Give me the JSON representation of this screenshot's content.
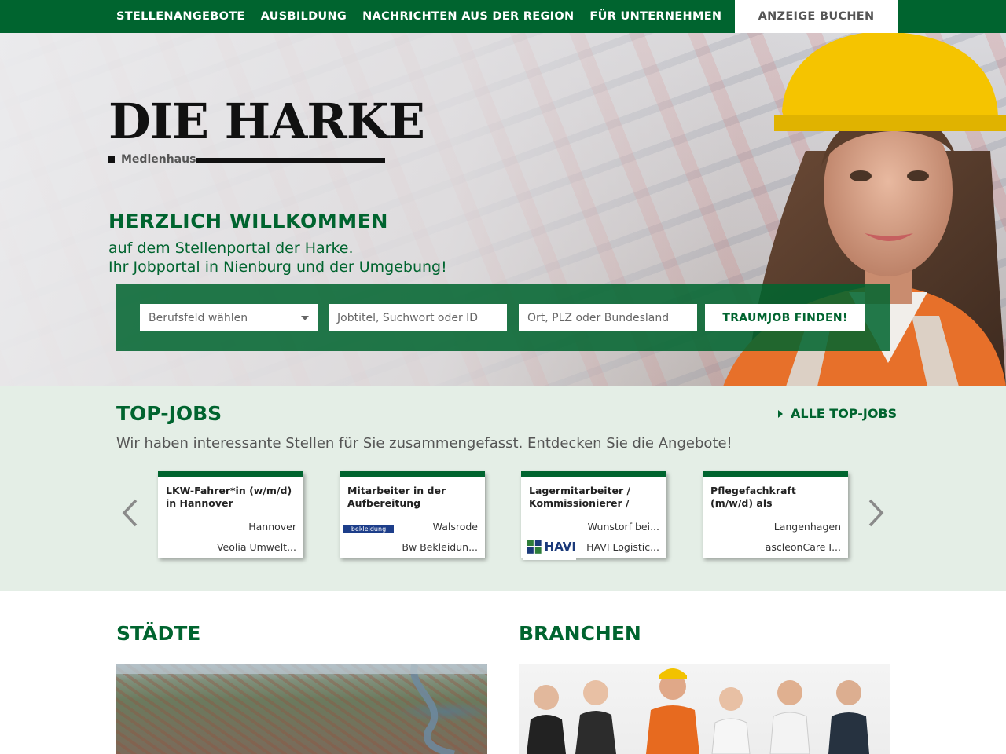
{
  "nav": {
    "links": [
      "STELLENANGEBOTE",
      "AUSBILDUNG",
      "NACHRICHTEN AUS DER REGION",
      "FÜR UNTERNEHMEN"
    ],
    "cta": "ANZEIGE BUCHEN"
  },
  "logo": {
    "line1": "DIE HARKE",
    "sub": "Medienhaus"
  },
  "hero": {
    "title": "HERZLICH WILLKOMMEN",
    "line1": "auf dem Stellenportal der Harke.",
    "line2": "Ihr Jobportal in Nienburg und der Umgebung!"
  },
  "search": {
    "category_placeholder": "Berufsfeld wählen",
    "keyword_placeholder": "Jobtitel, Suchwort oder ID",
    "location_placeholder": "Ort, PLZ oder Bundesland",
    "button": "TRAUMJOB FINDEN!"
  },
  "topjobs": {
    "title": "TOP-JOBS",
    "all_link": "ALLE TOP-JOBS",
    "intro": "Wir haben interessante Stellen für Sie zusammengefasst. Entdecken Sie die Angebote!",
    "cards": [
      {
        "title": "LKW-Fahrer*in (w/m/d) in Hannover",
        "city": "Hannover",
        "company": "Veolia Umwelt..."
      },
      {
        "title": "Mitarbeiter in der Aufbereitung Wäscherei...",
        "city": "Walsrode",
        "company": "Bw Bekleidun...",
        "logo": "bekleidung"
      },
      {
        "title": "Lagermitarbeiter / Kommissionierer / Lager...",
        "city": "Wunstorf bei...",
        "company": "HAVI Logistic...",
        "logo": "HAVI"
      },
      {
        "title": "Pflegefachkraft (m/w/d) als Schulbegleitung für e...",
        "city": "Langenhagen",
        "company": "ascleonCare I..."
      }
    ]
  },
  "sections": {
    "cities": "STÄDTE",
    "branches": "BRANCHEN"
  },
  "colors": {
    "brand_green": "#00642f",
    "light_green_bg": "#e4eee6"
  }
}
